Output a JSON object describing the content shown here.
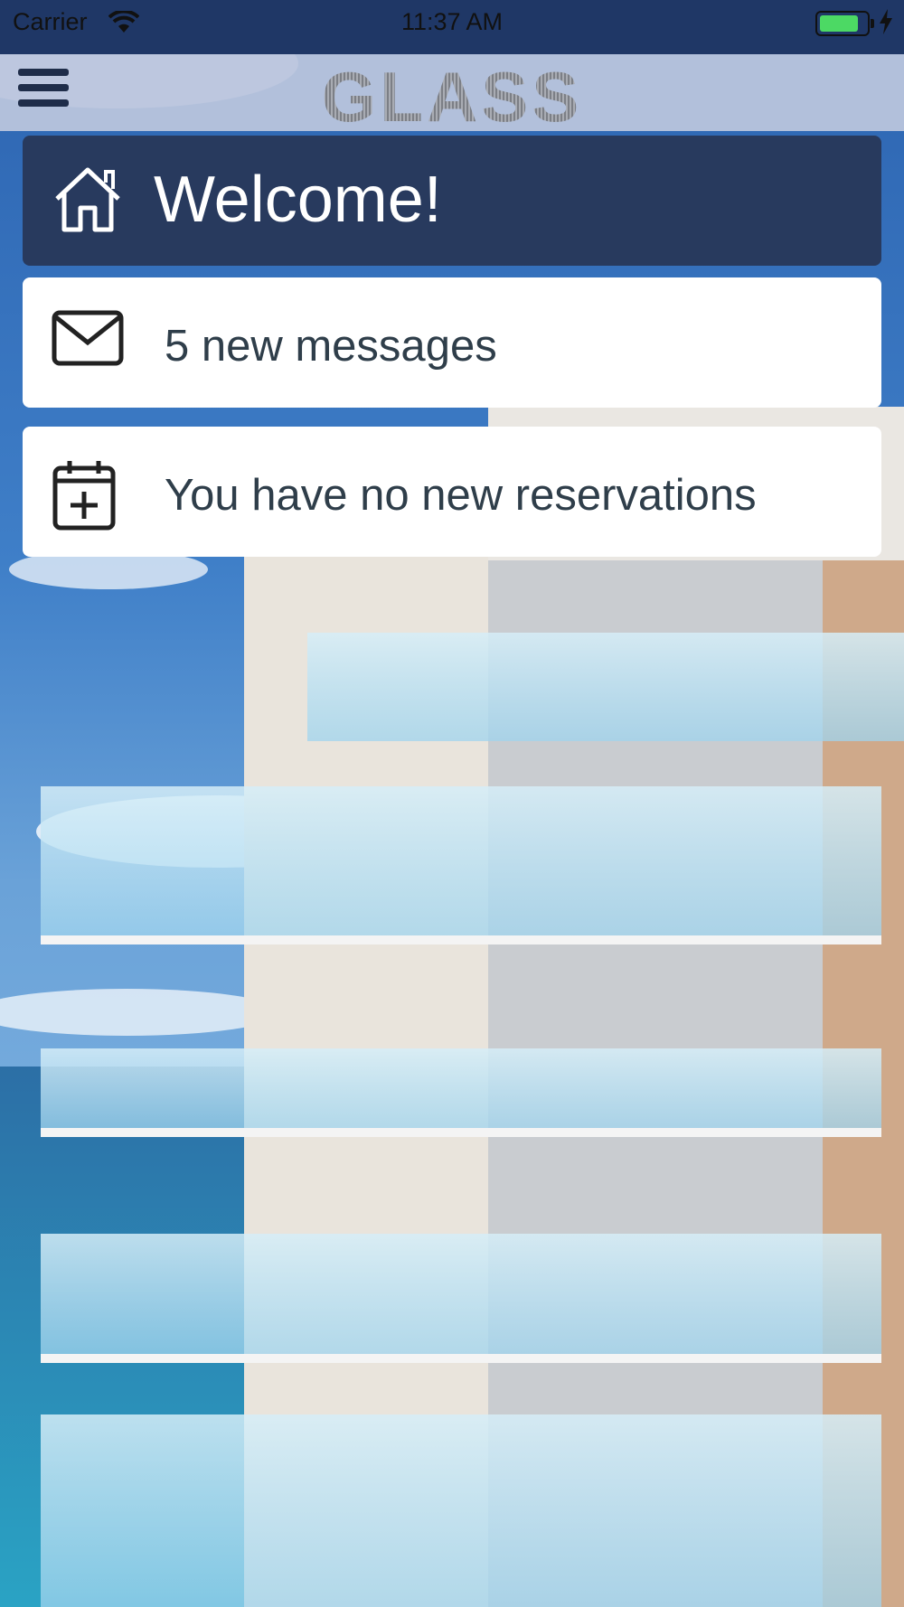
{
  "status_bar": {
    "carrier": "Carrier",
    "time": "11:37 AM",
    "battery_color": "#4cd964"
  },
  "nav": {
    "logo": "GLASS",
    "menu_icon": "hamburger-icon"
  },
  "welcome": {
    "title": "Welcome!",
    "icon": "home-icon"
  },
  "messages": {
    "text": "5 new messages",
    "icon": "envelope-icon"
  },
  "reservations": {
    "text": "You have no new reservations",
    "icon": "calendar-plus-icon"
  },
  "colors": {
    "navy": "#283a5e",
    "status_bg": "#1f3766",
    "card_text": "#2f3e4a"
  }
}
